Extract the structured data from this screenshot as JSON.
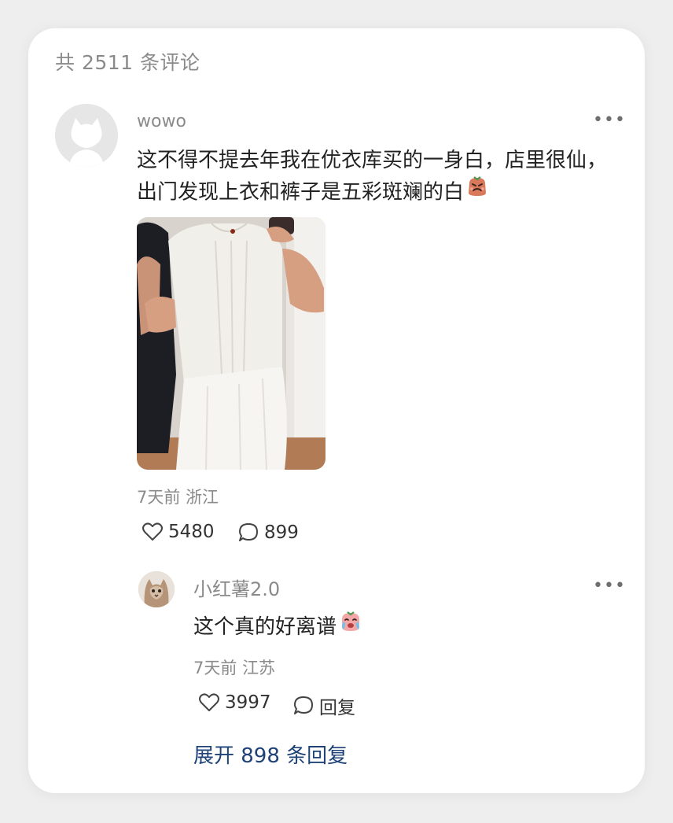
{
  "header": {
    "comment_count": "共 2511 条评论"
  },
  "comment": {
    "username": "wowo",
    "text": "这不得不提去年我在优衣库买的一身白，店里很仙，出门发现上衣和裤子是五彩斑斓的白",
    "emoji": "angry-face-emoji",
    "photo_icon": "outfit-photo",
    "time": "7天前",
    "location": "浙江",
    "likes": "5480",
    "replies": "899"
  },
  "reply": {
    "username": "小红薯2.0",
    "text": "这个真的好离谱",
    "emoji": "crying-face-emoji",
    "time": "7天前",
    "location": "江苏",
    "likes": "3997",
    "reply_label": "回复"
  },
  "expand_label": "展开 898 条回复",
  "more_icon": "more-icon",
  "accent_color": "#1f4377"
}
